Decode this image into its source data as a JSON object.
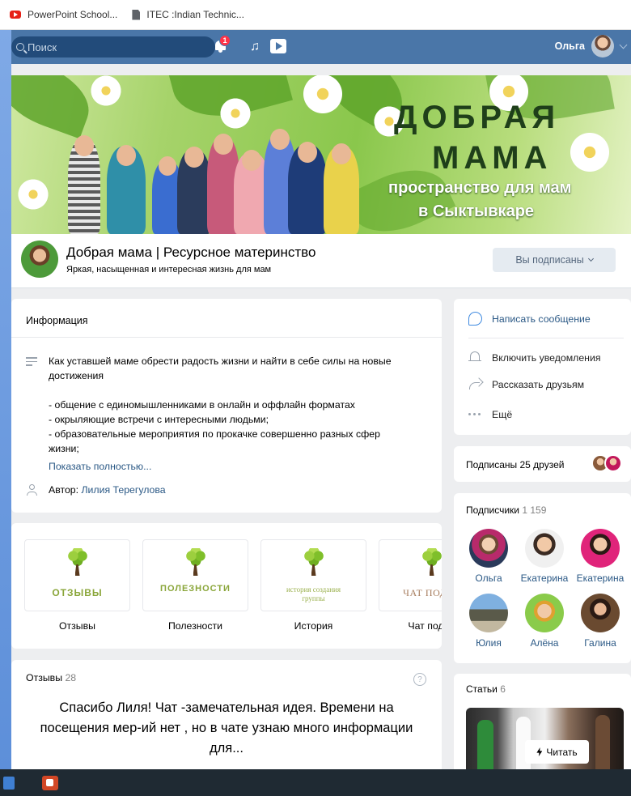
{
  "browser": {
    "bookmarks": [
      {
        "label": "PowerPoint School..."
      },
      {
        "label": "ITEC :Indian Technic..."
      }
    ]
  },
  "header": {
    "search_placeholder": "Поиск",
    "notifications_count": "1",
    "user_name": "Ольга"
  },
  "cover": {
    "title_line1": "ДОБРАЯ",
    "title_line2": "МАМА",
    "subtitle_line1": "пространство для мам",
    "subtitle_line2": "в Сыктывкаре"
  },
  "group": {
    "name": "Добрая мама | Ресурсное материнство",
    "status": "Яркая, насыщенная и интересная жизнь для мам",
    "subscribe_label": "Вы подписаны"
  },
  "info": {
    "title": "Информация",
    "desc_lines": [
      "Как уставшей маме обрести радость жизни и найти в себе силы на новые",
      "достижения",
      "",
      "- общение с единомышленниками в онлайн и оффлайн форматах",
      "- окрыляющие встречи с интересными людьми;",
      "- образовательные мероприятия по прокачке совершенно разных сфер",
      "жизни;"
    ],
    "show_more": "Показать полностью...",
    "author_label": "Автор:",
    "author_name": "Лилия Терегулова"
  },
  "sections": [
    {
      "tile_text": "ОТЗЫВЫ",
      "label": "Отзывы"
    },
    {
      "tile_text": "ПОЛЕЗНОСТИ",
      "label": "Полезности"
    },
    {
      "tile_text": "история создания группы",
      "label": "История"
    },
    {
      "tile_text": "ЧАТ ПОДДЕ",
      "label": "Чат подде"
    }
  ],
  "reviews": {
    "title": "Отзывы",
    "count": "28",
    "help_icon": "?",
    "text": "Спасибо Лиля! Чат -замечательная идея. Времени на посещения мер-ий нет , но в чате узнаю много информации для..."
  },
  "actions": [
    {
      "label": "Написать сообщение",
      "icon": "message-icon"
    },
    {
      "label": "Включить уведомления",
      "icon": "bell-icon"
    },
    {
      "label": "Рассказать друзьям",
      "icon": "share-icon"
    },
    {
      "label": "Ещё",
      "icon": "more-icon"
    }
  ],
  "friends": {
    "label": "Подписаны 25 друзей"
  },
  "subscribers": {
    "title": "Подписчики",
    "count": "1 159",
    "people": [
      {
        "name": "Ольга"
      },
      {
        "name": "Екатерина"
      },
      {
        "name": "Екатерина"
      },
      {
        "name": "Юлия"
      },
      {
        "name": "Алёна"
      },
      {
        "name": "Галина"
      }
    ]
  },
  "articles": {
    "title": "Статьи",
    "count": "6",
    "read_label": "Читать"
  },
  "colors": {
    "vk_header": "#4a76a8",
    "link": "#2a5885",
    "page_bg": "#edeef0",
    "taskbar": "#1f2a33"
  }
}
